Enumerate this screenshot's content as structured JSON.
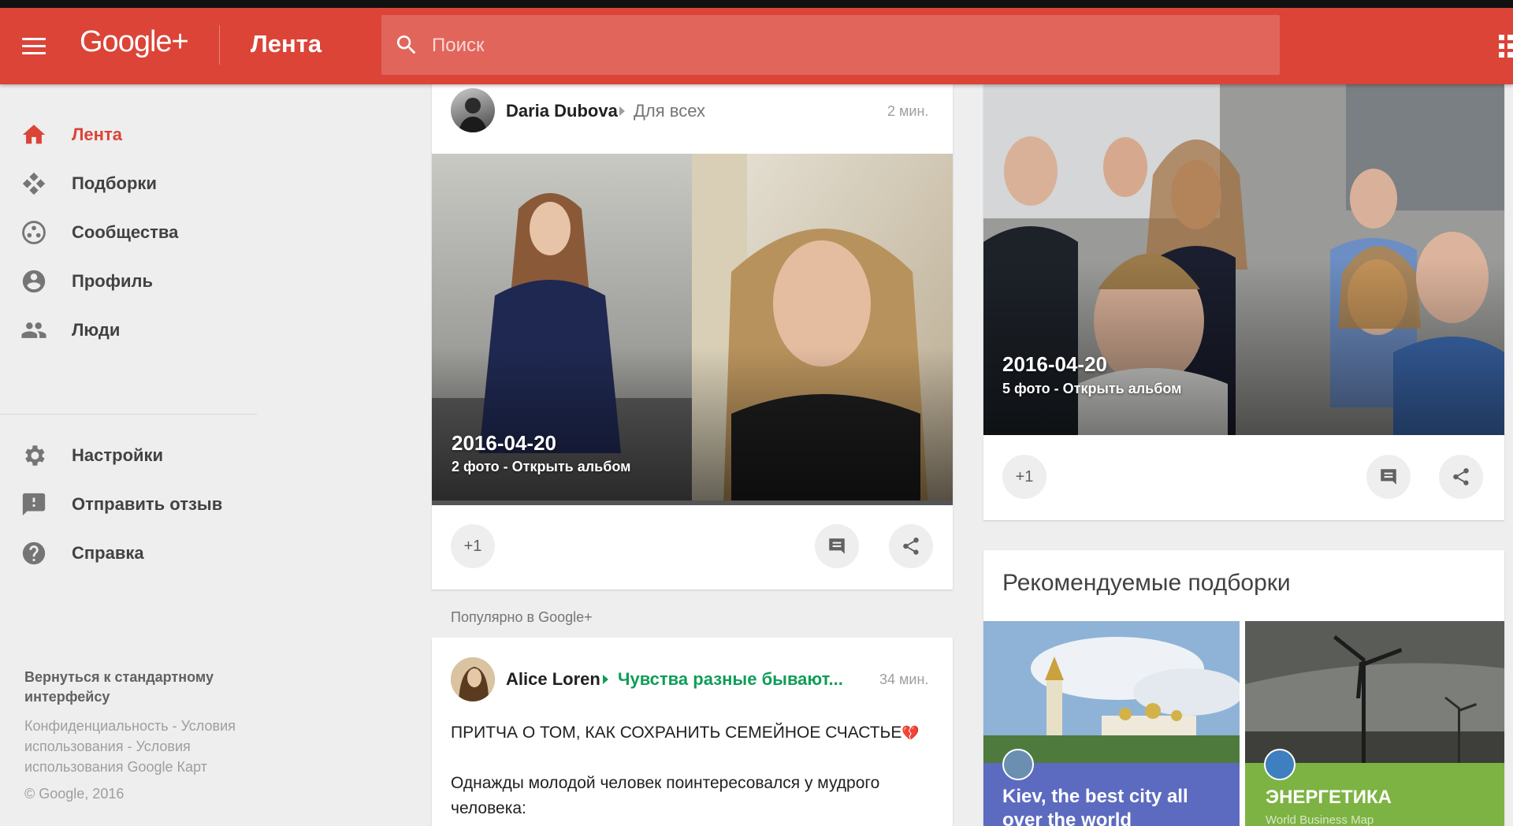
{
  "header": {
    "brand": "Google+",
    "page_title": "Лента",
    "search_placeholder": "Поиск",
    "brand_color": "#db4437",
    "menu_icon": "hamburger-icon",
    "apps_icon": "apps-grid-icon"
  },
  "sidebar": {
    "items": [
      {
        "label": "Лента",
        "icon": "home-icon",
        "active": true
      },
      {
        "label": "Подборки",
        "icon": "collections-icon",
        "active": false
      },
      {
        "label": "Сообщества",
        "icon": "communities-icon",
        "active": false
      },
      {
        "label": "Профиль",
        "icon": "profile-icon",
        "active": false
      },
      {
        "label": "Люди",
        "icon": "people-icon",
        "active": false
      },
      {
        "label": "Настройки",
        "icon": "settings-icon",
        "active": false
      },
      {
        "label": "Отправить отзыв",
        "icon": "feedback-icon",
        "active": false
      },
      {
        "label": "Справка",
        "icon": "help-icon",
        "active": false
      }
    ],
    "footer": {
      "classic_link": "Вернуться к стандартному интерфейсу",
      "legal": "Конфиденциальность - Условия использования - Условия использования Google Карт",
      "copyright": "© Google, 2016"
    }
  },
  "post1": {
    "author": "Daria Dubova",
    "audience": "Для всех",
    "time": "2 мин.",
    "album_date": "2016-04-20",
    "album_info": "2 фото - Открыть альбом",
    "plus_one": "+1"
  },
  "popular_label": "Популярно в Google+",
  "post2": {
    "author": "Alice Loren",
    "community": "Чувства разные бывают...",
    "time": "34 мин.",
    "title": "ПРИТЧА О ТОМ, КАК СОХРАНИТЬ СЕМЕЙНОЕ СЧАСТЬЕ",
    "title_emoji": "💔",
    "body": "Однажды молодой человек поинтересовался у мудрого человека:"
  },
  "post3": {
    "album_date": "2016-04-20",
    "album_info": "5 фото - Открыть альбом",
    "plus_one": "+1"
  },
  "recommended": {
    "heading": "Рекомендуемые подборки",
    "tiles": [
      {
        "name": "Kiev, the best city all over the world",
        "owner": "",
        "color": "#5c6bc0"
      },
      {
        "name": "ЭНЕРГЕТИКА",
        "owner": "World Business Map",
        "color": "#7cb342"
      }
    ]
  },
  "colors": {
    "accent": "#db4437",
    "community_green": "#0f9d58"
  }
}
